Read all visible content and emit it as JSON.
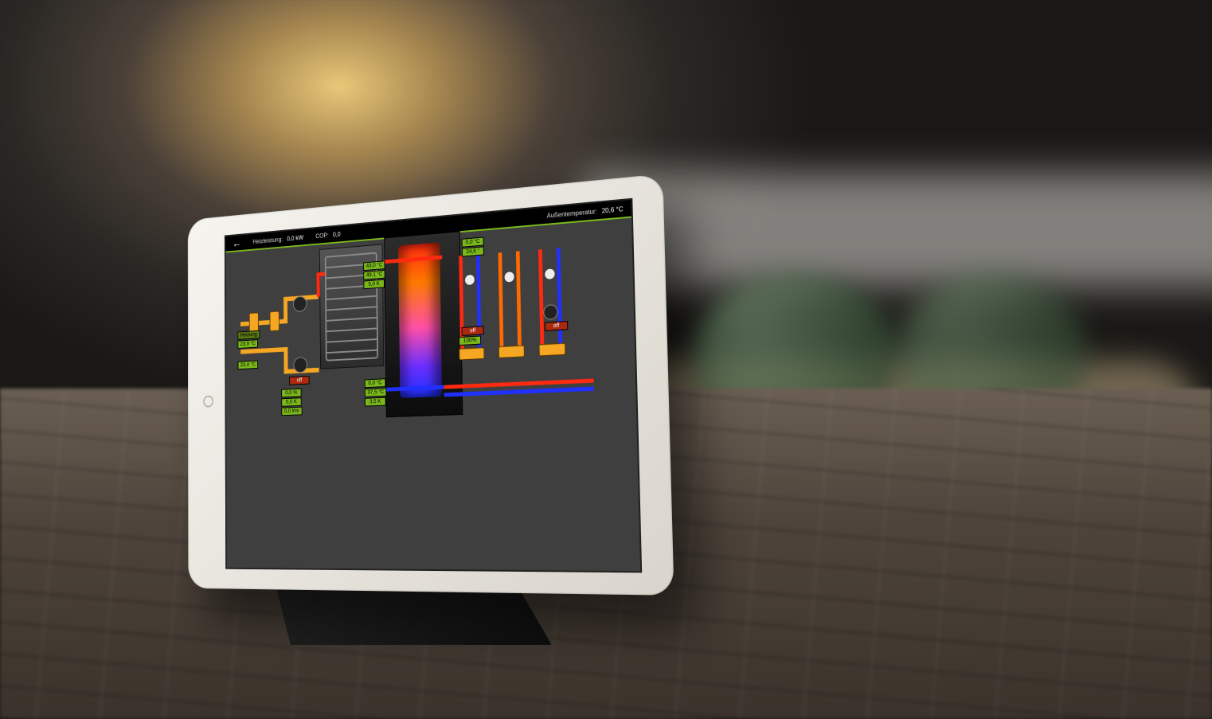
{
  "topbar": {
    "heizleistung_label": "Heizleistung:",
    "heizleistung_value": "0,0 kW",
    "cop_label": "COP:",
    "cop_value": "0,0",
    "aussentemp_label": "Außentemperatur:",
    "aussentemp_value": "20,6 °C"
  },
  "left_circuit": {
    "heizung_label": "Heizung",
    "temp_flow": "23,9 °C",
    "temp_return": "23,4 °C",
    "status": "off",
    "valve_percent": "0,0 %",
    "delta": "5,0 K",
    "flow": "0,0 l/mi"
  },
  "tank": {
    "top_temp": "43,0 °C",
    "upper_temp": "49,1 °C",
    "upper_delta": "5,0 K",
    "lower_temp": "0,0 °C",
    "lower_mid_temp": "37,5 °C",
    "lower_delta": "3,5 K"
  },
  "right_header": {
    "temp": "0,0 °C",
    "temp2": "24,6 °"
  },
  "right_circuits": [
    {
      "status": "off",
      "valve": "100%"
    },
    {
      "status": "off"
    }
  ]
}
